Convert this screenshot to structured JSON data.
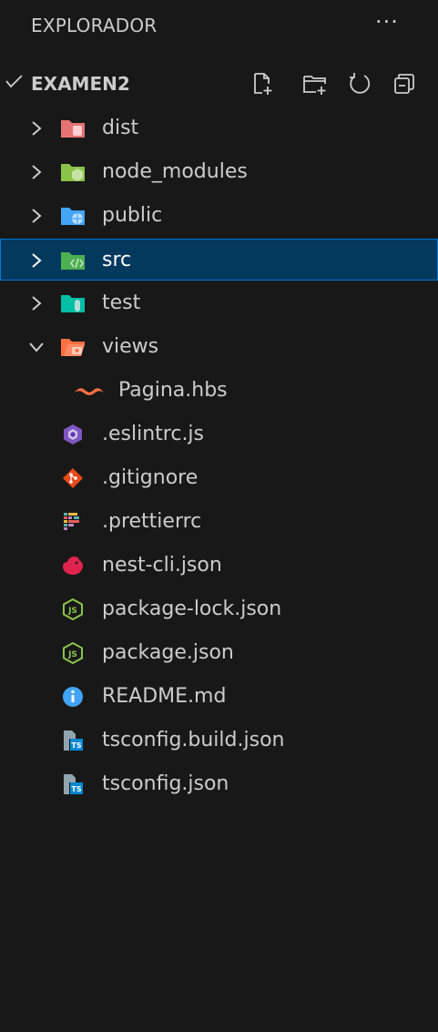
{
  "explorer": {
    "title": "EXPLORADOR",
    "more": "···",
    "root": {
      "name": "EXAMEN2",
      "toolbar": [
        "new-file-icon",
        "new-folder-icon",
        "refresh-icon",
        "collapse-all-icon"
      ]
    },
    "folders": [
      {
        "name": "dist",
        "icon": "folder-dist-icon",
        "color": "#e57373",
        "expanded": false
      },
      {
        "name": "node_modules",
        "icon": "folder-node-icon",
        "color": "#8bc34a",
        "expanded": false
      },
      {
        "name": "public",
        "icon": "folder-public-icon",
        "color": "#42a5f5",
        "expanded": false
      },
      {
        "name": "src",
        "icon": "folder-src-icon",
        "color": "#4caf50",
        "expanded": false,
        "selected": true
      },
      {
        "name": "test",
        "icon": "folder-test-icon",
        "color": "#00bfa5",
        "expanded": false
      },
      {
        "name": "views",
        "icon": "folder-views-icon",
        "color": "#ff7043",
        "expanded": true
      }
    ],
    "view_children": [
      {
        "name": "Pagina.hbs",
        "icon": "handlebars-icon",
        "color": "#ff7043"
      }
    ],
    "files": [
      {
        "name": ".eslintrc.js",
        "icon": "eslint-icon",
        "color": "#7e57c2"
      },
      {
        "name": ".gitignore",
        "icon": "git-icon",
        "color": "#e64a19"
      },
      {
        "name": ".prettierrc",
        "icon": "prettier-icon",
        "color": "#56b3b4"
      },
      {
        "name": "nest-cli.json",
        "icon": "nestjs-icon",
        "color": "#e0234e"
      },
      {
        "name": "package-lock.json",
        "icon": "nodejs-icon",
        "color": "#8bc34a"
      },
      {
        "name": "package.json",
        "icon": "nodejs-icon",
        "color": "#8bc34a"
      },
      {
        "name": "README.md",
        "icon": "info-icon",
        "color": "#42a5f5"
      },
      {
        "name": "tsconfig.build.json",
        "icon": "tsconfig-icon",
        "color": "#0288d1"
      },
      {
        "name": "tsconfig.json",
        "icon": "tsconfig-icon",
        "color": "#0288d1"
      }
    ]
  }
}
